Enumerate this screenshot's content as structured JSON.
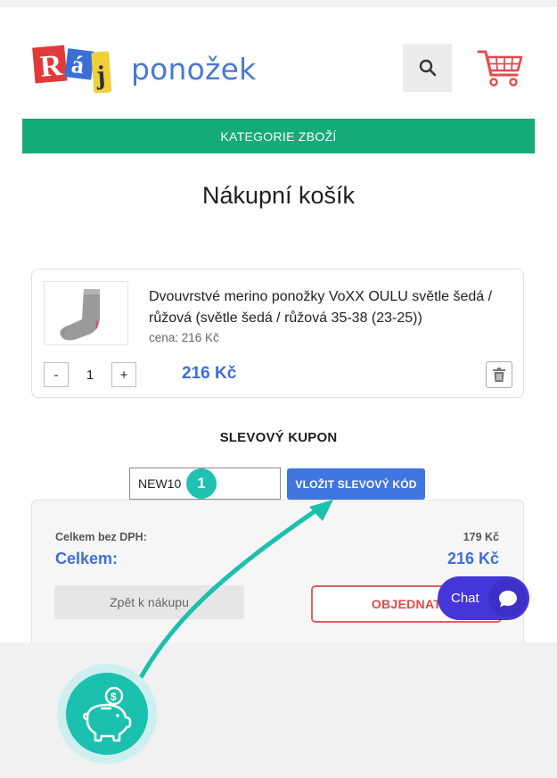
{
  "header": {
    "logo_text": "Ráj",
    "brand_name": "ponožek",
    "category_bar_label": "KATEGORIE ZBOŽÍ"
  },
  "page": {
    "title": "Nákupní košík"
  },
  "cart_item": {
    "name": "Dvouvrstvé merino ponožky VoXX OULU světle šedá / růžová (světle šedá / růžová 35-38 (23-25))",
    "unit_price": "cena: 216 Kč",
    "minus_label": "-",
    "quantity": "1",
    "plus_label": "+",
    "line_total": "216 Kč"
  },
  "coupon": {
    "title": "SLEVOVÝ KUPON",
    "input_value": "NEW10",
    "button_label": "VLOŽIT SLEVOVÝ KÓD",
    "step_number": "1"
  },
  "summary": {
    "subtotal_label": "Celkem bez DPH:",
    "subtotal_value": "179 Kč",
    "total_label": "Celkem:",
    "total_value": "216 Kč",
    "back_label": "Zpět k nákupu",
    "order_label": "OBJEDNAT"
  },
  "chat": {
    "label": "Chat"
  },
  "colors": {
    "green_bar": "#15ab78",
    "accent_blue": "#4176e0",
    "order_red": "#e04848",
    "chat_purple": "#4436d8",
    "tutorial_teal": "#1cc0ae"
  },
  "icons": [
    "search-icon",
    "cart-icon",
    "trash-icon",
    "chat-bubble-icon",
    "piggy-bank-icon"
  ]
}
